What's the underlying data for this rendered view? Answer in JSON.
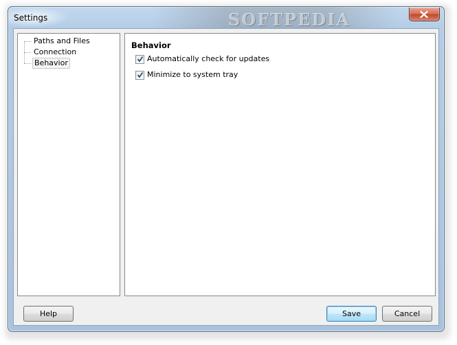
{
  "window": {
    "title": "Settings",
    "watermark": "SOFTPEDIA"
  },
  "tree": {
    "items": [
      {
        "label": "Paths and Files",
        "selected": false
      },
      {
        "label": "Connection",
        "selected": false
      },
      {
        "label": "Behavior",
        "selected": true
      }
    ]
  },
  "panel": {
    "title": "Behavior",
    "options": [
      {
        "label": "Automatically check for updates",
        "checked": true
      },
      {
        "label": "Minimize to system tray",
        "checked": true
      }
    ]
  },
  "buttons": {
    "help": "Help",
    "save": "Save",
    "cancel": "Cancel"
  },
  "colors": {
    "frame": "#b4cde6",
    "close_button": "#c24a2d",
    "default_button_border": "#3c7fb1"
  },
  "icons": {
    "close": "close-icon",
    "check": "checkmark-icon"
  }
}
